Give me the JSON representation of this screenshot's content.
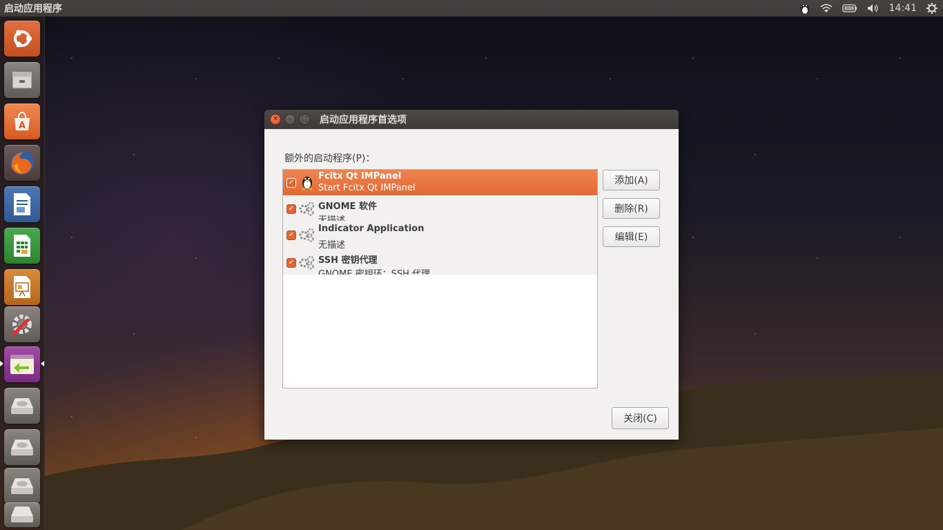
{
  "top_panel": {
    "app_title": "启动应用程序",
    "clock": "14:41",
    "indicators": [
      "fcitx-penguin-icon",
      "wifi-icon",
      "battery-icon",
      "volume-icon",
      "settings-gear-icon"
    ]
  },
  "launcher": {
    "items": [
      {
        "name": "ubuntu-dash-icon"
      },
      {
        "name": "files-icon"
      },
      {
        "name": "software-center-icon"
      },
      {
        "name": "firefox-icon"
      },
      {
        "name": "writer-icon"
      },
      {
        "name": "calc-icon"
      },
      {
        "name": "impress-icon"
      },
      {
        "name": "system-settings-icon"
      },
      {
        "name": "startup-applications-icon",
        "active": true
      },
      {
        "name": "drive-icon-1"
      },
      {
        "name": "drive-icon-2"
      },
      {
        "name": "drive-icon-3"
      },
      {
        "name": "drive-icon-4"
      }
    ]
  },
  "dialog": {
    "title": "启动应用程序首选项",
    "section_label": "额外的启动程序(P)：",
    "programs": [
      {
        "name": "Fcitx Qt IMPanel",
        "description": "Start Fcitx Qt IMPanel",
        "checked": true,
        "selected": true,
        "icon": "penguin-icon"
      },
      {
        "name": "GNOME 软件",
        "description": "无描述",
        "checked": true,
        "selected": false,
        "icon": "gears-icon"
      },
      {
        "name": "Indicator Application",
        "description": "无描述",
        "checked": true,
        "selected": false,
        "icon": "gears-icon"
      },
      {
        "name": "SSH 密钥代理",
        "description": "GNOME 密钥环：SSH 代理",
        "checked": true,
        "selected": false,
        "icon": "gears-icon"
      }
    ],
    "buttons": {
      "add": "添加(A)",
      "remove": "删除(R)",
      "edit": "编辑(E)",
      "close": "关闭(C)"
    }
  },
  "colors": {
    "accent": "#e16a33",
    "panel": "#3c3b37",
    "dialog_bg": "#f2f1f0"
  }
}
